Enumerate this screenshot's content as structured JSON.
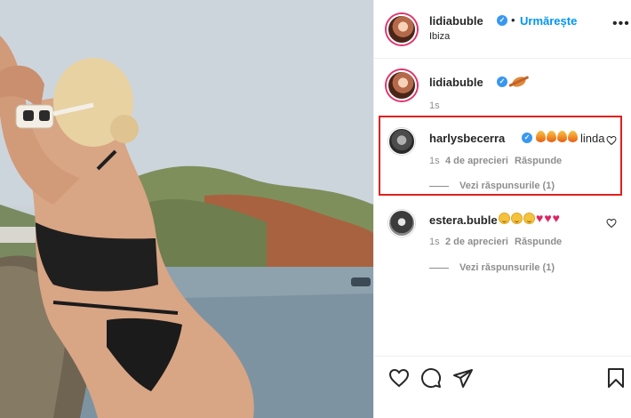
{
  "post": {
    "author": "lidiabuble",
    "follow_label": "Urmărește",
    "location": "Ibiza",
    "more_icon": "more-horizontal-icon"
  },
  "caption": {
    "author": "lidiabuble",
    "emoji": "planet-emoji",
    "time": "1s"
  },
  "comments": [
    {
      "author": "harlysbecerra",
      "verified": true,
      "emojis": [
        "fire",
        "fire",
        "fire",
        "fire"
      ],
      "text": "linda",
      "time": "1s",
      "likes": "4 de aprecieri",
      "reply_label": "Răspunde",
      "view_replies": "Vezi răspunsurile (1)",
      "highlighted": true
    },
    {
      "author": "estera.buble",
      "verified": false,
      "emojis": [
        "smile",
        "smile",
        "smile",
        "heart",
        "heart",
        "heart"
      ],
      "text": "",
      "time": "1s",
      "likes": "2 de aprecieri",
      "reply_label": "Răspunde",
      "view_replies": "Vezi răspunsurile (1)",
      "highlighted": false
    }
  ],
  "colors": {
    "accent": "#0095f6",
    "verified": "#3897f0",
    "highlight_border": "#e02020",
    "heart": "#e0245e"
  },
  "actions": {
    "like_icon": "heart-icon",
    "comment_icon": "comment-icon",
    "share_icon": "send-icon",
    "save_icon": "bookmark-icon"
  }
}
